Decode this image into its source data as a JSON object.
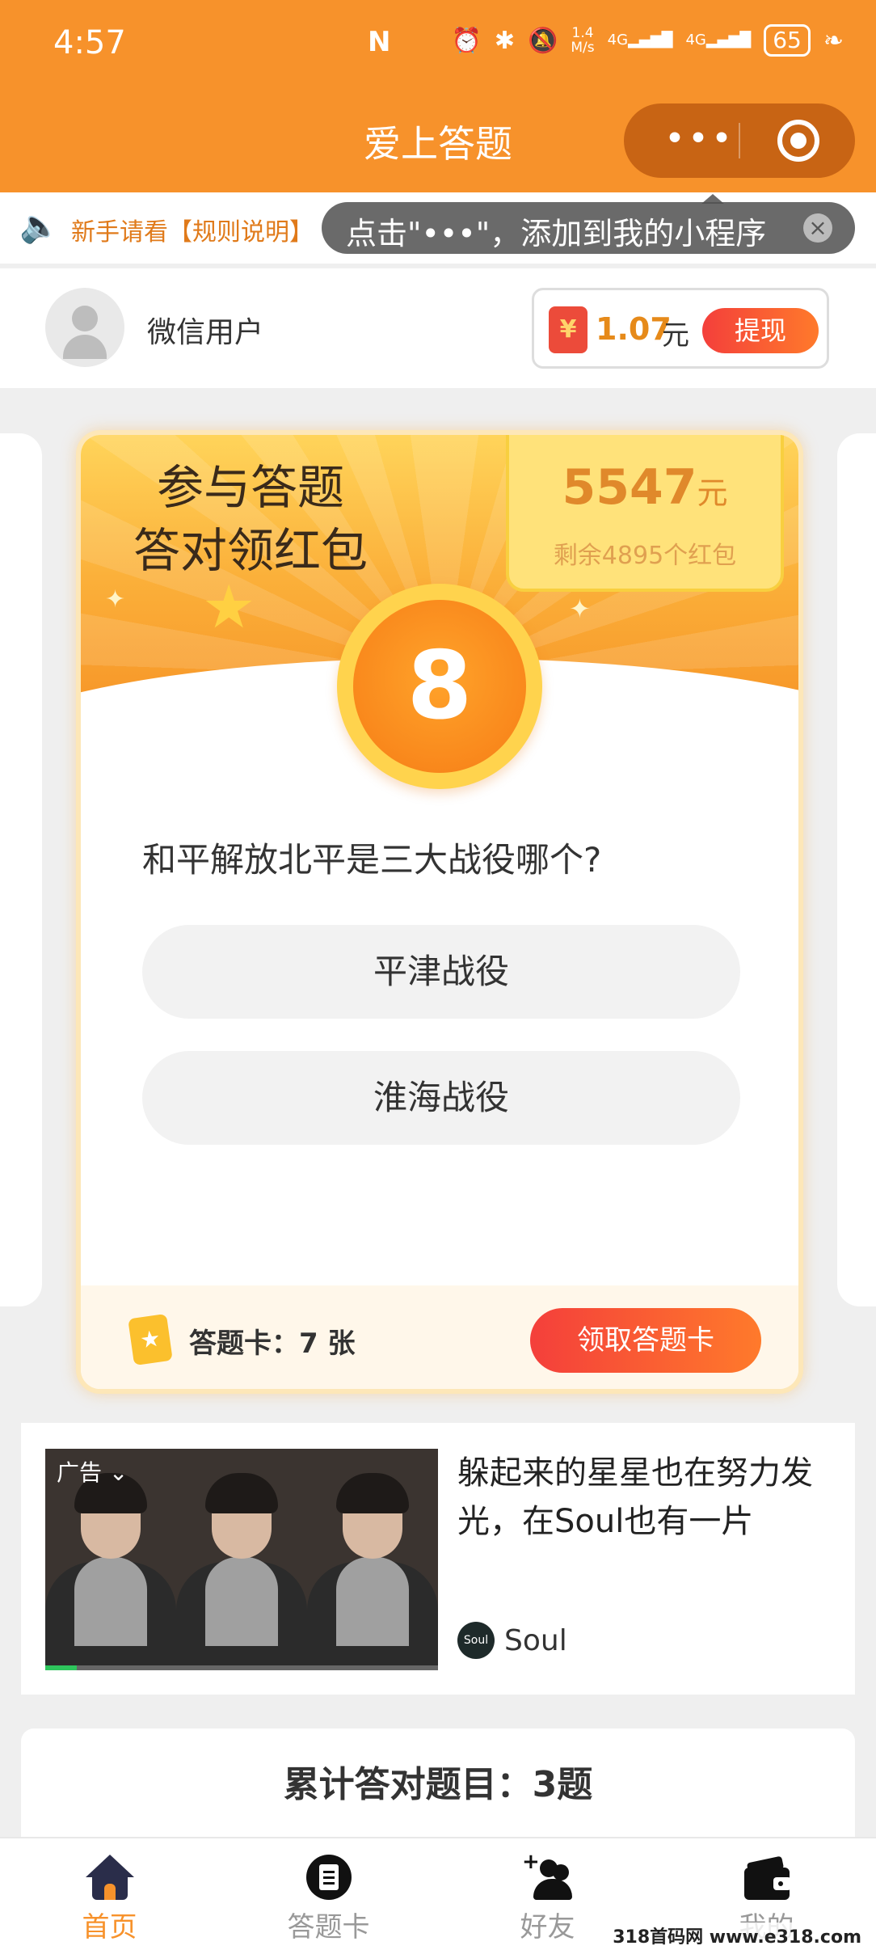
{
  "status_bar": {
    "time": "4:57",
    "nfc": "N",
    "speed_value": "1.4",
    "speed_unit": "M/s",
    "net1": "4G",
    "net2": "4G",
    "battery": "65"
  },
  "nav": {
    "title": "爱上答题",
    "more_icon": "more-dots-icon",
    "close_icon": "target-circle-icon"
  },
  "notice": {
    "text": "新手请看【规则说明】",
    "speaker_icon": "speaker-icon"
  },
  "toast": {
    "message": "点击\"•••\"，添加到我的小程序",
    "close_glyph": "×"
  },
  "user": {
    "name": "微信用户",
    "balance": "1.07",
    "balance_unit": "元",
    "withdraw_label": "提现",
    "redpack_glyph": "¥"
  },
  "card": {
    "headline_line1": "参与答题",
    "headline_line2": "答对领红包",
    "prize_amount": "5547",
    "prize_unit": "元",
    "remaining": "剩余4895个红包",
    "question_number": "8",
    "question": "和平解放北平是三大战役哪个?",
    "options": [
      "平津战役",
      "淮海战役"
    ],
    "answer_cards_label": "答题卡：7 张",
    "get_cards_label": "领取答题卡"
  },
  "ad": {
    "tag": "广告",
    "headline": "躲起来的星星也在努力发光，在Soul也有一片",
    "brand_name": "Soul",
    "brand_logo_text": "Soul",
    "video_progress": 0.08
  },
  "stats": {
    "total_correct": "累计答对题目：3题"
  },
  "tabbar": {
    "items": [
      {
        "label": "首页",
        "icon": "home-icon",
        "active": true
      },
      {
        "label": "答题卡",
        "icon": "answer-card-icon",
        "active": false
      },
      {
        "label": "好友",
        "icon": "add-friend-icon",
        "active": false
      },
      {
        "label": "我的",
        "icon": "wallet-icon",
        "active": false
      }
    ]
  },
  "watermark": "318首码网 www.e318.com",
  "colors": {
    "brand_orange": "#f7922b",
    "button_red": "#f43f3b",
    "gold": "#e0892b"
  }
}
